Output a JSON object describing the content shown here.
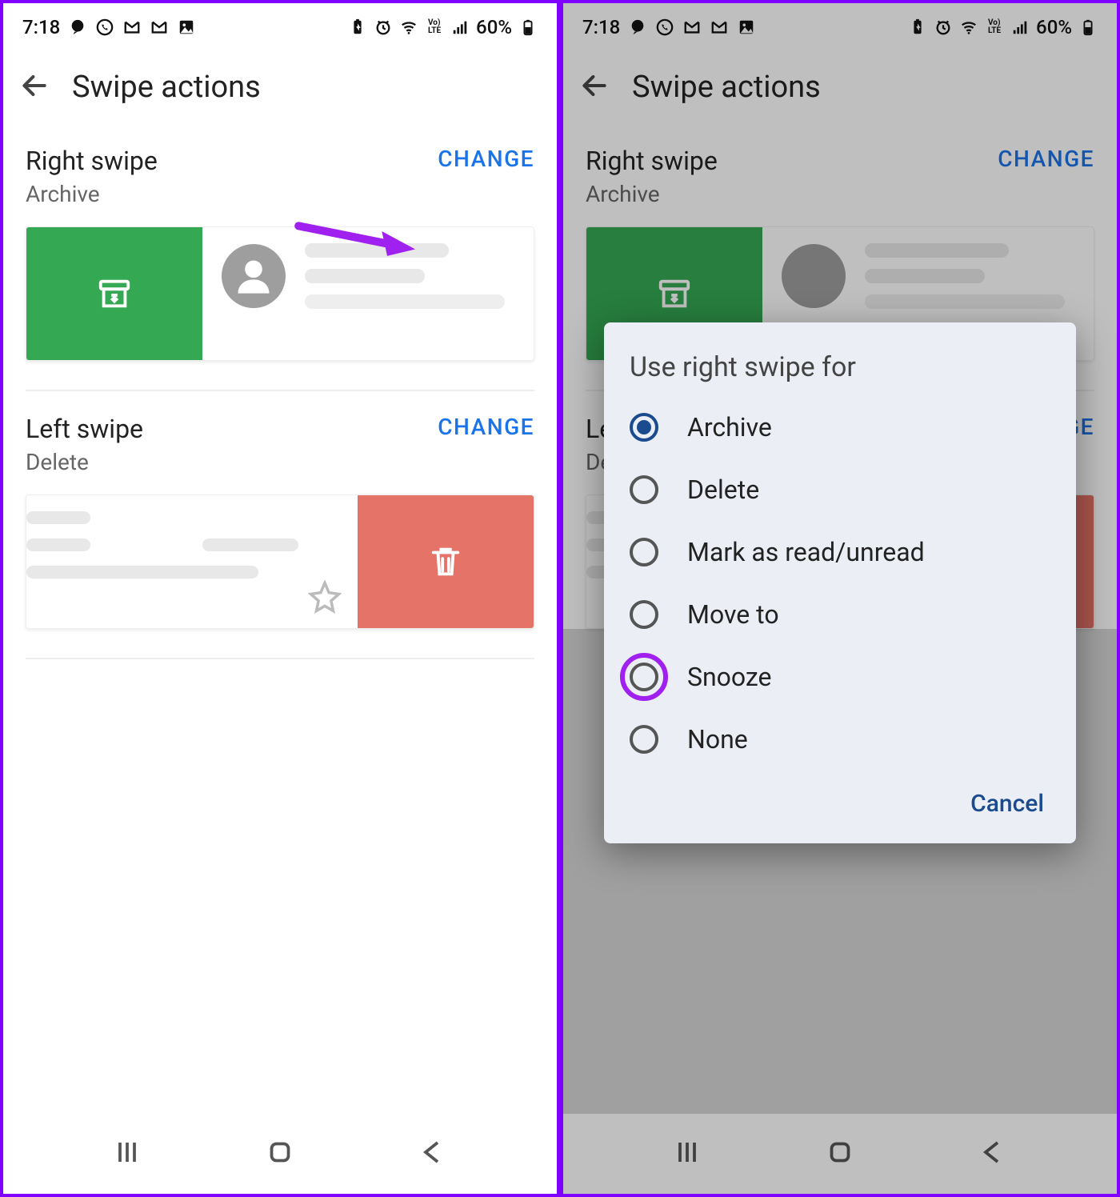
{
  "statusbar": {
    "time": "7:18",
    "battery": "60%"
  },
  "appbar": {
    "title": "Swipe actions"
  },
  "right_swipe": {
    "title": "Right swipe",
    "action": "Archive",
    "change": "CHANGE"
  },
  "left_swipe": {
    "title": "Left swipe",
    "action": "Delete",
    "change": "CHANGE"
  },
  "dialog": {
    "title": "Use right swipe for",
    "options": {
      "archive": "Archive",
      "delete": "Delete",
      "mark": "Mark as read/unread",
      "move": "Move to",
      "snooze": "Snooze",
      "none": "None"
    },
    "cancel": "Cancel"
  }
}
